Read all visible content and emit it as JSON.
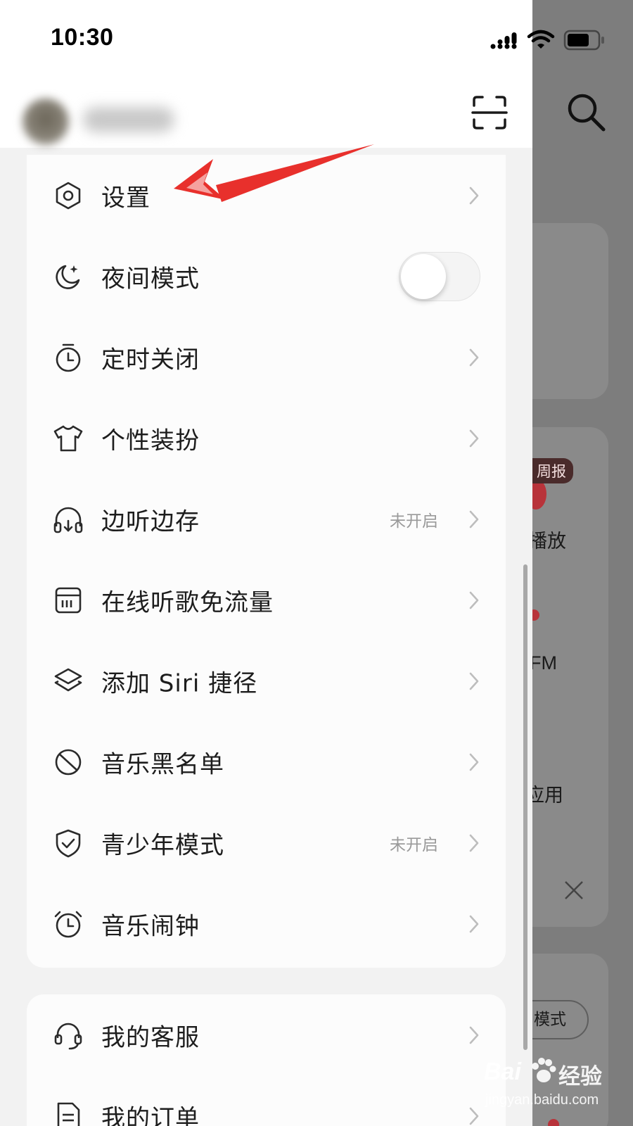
{
  "status_bar": {
    "time": "10:30"
  },
  "header": {
    "username": ""
  },
  "menu": {
    "items": [
      {
        "label": "设置",
        "status": "",
        "icon": "settings-icon",
        "control": "chevron"
      },
      {
        "label": "夜间模式",
        "status": "",
        "icon": "moon-icon",
        "control": "toggle",
        "toggle_on": false
      },
      {
        "label": "定时关闭",
        "status": "",
        "icon": "timer-icon",
        "control": "chevron"
      },
      {
        "label": "个性装扮",
        "status": "",
        "icon": "tshirt-icon",
        "control": "chevron"
      },
      {
        "label": "边听边存",
        "status": "未开启",
        "icon": "headphones-download-icon",
        "control": "chevron"
      },
      {
        "label": "在线听歌免流量",
        "status": "",
        "icon": "sim-card-icon",
        "control": "chevron"
      },
      {
        "label": "添加 Siri 捷径",
        "status": "",
        "icon": "layers-icon",
        "control": "chevron"
      },
      {
        "label": "音乐黑名单",
        "status": "",
        "icon": "block-icon",
        "control": "chevron"
      },
      {
        "label": "青少年模式",
        "status": "未开启",
        "icon": "shield-check-icon",
        "control": "chevron"
      },
      {
        "label": "音乐闹钟",
        "status": "",
        "icon": "alarm-clock-icon",
        "control": "chevron"
      }
    ]
  },
  "menu2": {
    "items": [
      {
        "label": "我的客服",
        "icon": "customer-service-icon"
      },
      {
        "label": "我的订单",
        "icon": "order-icon"
      }
    ]
  },
  "background": {
    "badge": "周报",
    "texts": [
      "播放",
      "FM",
      "应用",
      "模式"
    ]
  },
  "watermark": {
    "brand": "Bai",
    "brand_cn": "经验",
    "url": "jingyan.baidu.com"
  },
  "colors": {
    "annotation_arrow": "#e8302c",
    "accent_red": "#b8333a"
  }
}
